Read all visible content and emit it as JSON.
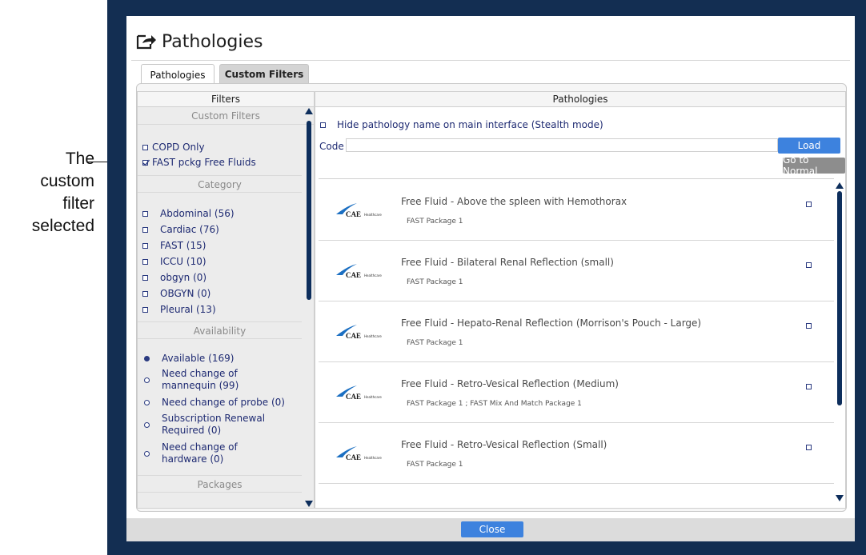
{
  "annotation": {
    "lines": [
      "The",
      "custom",
      "filter",
      "selected"
    ]
  },
  "dialog": {
    "title": "Pathologies",
    "icon": "export-arrow-icon"
  },
  "tabs": [
    {
      "label": "Pathologies",
      "active": true
    },
    {
      "label": "Custom Filters",
      "active": false
    }
  ],
  "filters": {
    "header": "Filters",
    "custom_filters": {
      "heading": "Custom Filters",
      "items": [
        {
          "label": "COPD Only",
          "checked": false
        },
        {
          "label": "FAST pckg Free Fluids",
          "checked": true
        }
      ]
    },
    "category": {
      "heading": "Category",
      "items": [
        {
          "label": "Abdominal (56)"
        },
        {
          "label": "Cardiac (76)"
        },
        {
          "label": "FAST (15)"
        },
        {
          "label": "ICCU (10)"
        },
        {
          "label": "obgyn (0)"
        },
        {
          "label": "OBGYN (0)"
        },
        {
          "label": "Pleural (13)"
        }
      ]
    },
    "availability": {
      "heading": "Availability",
      "items": [
        {
          "label": "Available (169)",
          "selected": true
        },
        {
          "label": "Need change of mannequin (99)",
          "selected": false
        },
        {
          "label": "Need change of probe (0)",
          "selected": false
        },
        {
          "label": "Subscription Renewal Required (0)",
          "selected": false
        },
        {
          "label": "Need change of hardware (0)",
          "selected": false
        }
      ]
    },
    "packages": {
      "heading": "Packages"
    }
  },
  "pathologies": {
    "header": "Pathologies",
    "stealth_label": "Hide pathology name on main interface (Stealth mode)",
    "code_label": "Code",
    "code_value": "",
    "load_label": "Load",
    "go_normal_label": "Go to Normal",
    "logo_text": "CAE",
    "logo_sub": "Healthcare",
    "items": [
      {
        "title": "Free Fluid - Above the spleen with Hemothorax",
        "package": "FAST Package 1"
      },
      {
        "title": "Free Fluid - Bilateral Renal Reflection (small)",
        "package": "FAST Package 1"
      },
      {
        "title": "Free Fluid - Hepato-Renal Reflection (Morrison's Pouch - Large)",
        "package": "FAST Package 1"
      },
      {
        "title": "Free Fluid - Retro-Vesical Reflection (Medium)",
        "package": "FAST Package 1 ; FAST Mix And Match Package 1"
      },
      {
        "title": "Free Fluid - Retro-Vesical Reflection (Small)",
        "package": "FAST Package 1"
      }
    ]
  },
  "footer": {
    "close_label": "Close"
  },
  "colors": {
    "frame": "#132e52",
    "button_blue": "#3d82de",
    "button_gray": "#8d8d8d",
    "scrollbar": "#0d2e5c",
    "link_text": "#1e2a72"
  }
}
